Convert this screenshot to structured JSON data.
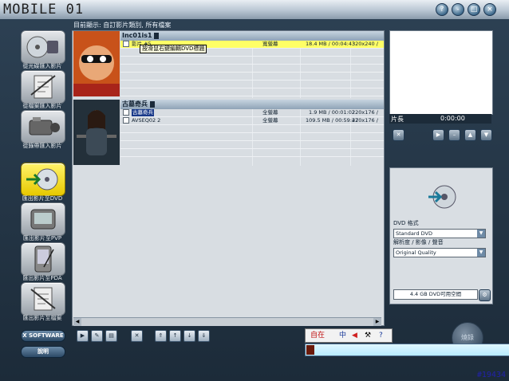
{
  "window": {
    "logo": "MOBILE 01",
    "controls": [
      "?",
      "-",
      "□",
      "×"
    ]
  },
  "sidebar": {
    "items": [
      {
        "label": "從光碟匯入影片",
        "icon": "disc-import-icon"
      },
      {
        "label": "從檔案匯入影片",
        "icon": "file-import-icon"
      },
      {
        "label": "從錄帶匯入影片",
        "icon": "camcorder-icon"
      },
      {
        "label": "匯出影片至DVD",
        "icon": "dvd-export-icon"
      },
      {
        "label": "匯出影片至PVP",
        "icon": "pvp-export-icon"
      },
      {
        "label": "匯出影片至PDA",
        "icon": "pda-export-icon"
      },
      {
        "label": "匯出影片至檔案",
        "icon": "file-export-icon"
      }
    ],
    "brand_button": "X SOFTWARE",
    "help_button": "說明"
  },
  "info_text": "目前顯示: 自訂影片類別, 所有檔案",
  "groups": [
    {
      "title": "Inc01is1",
      "tooltip": "按滑鼠右鍵編輯DVD標題",
      "rows": [
        {
          "name": "影片 #5",
          "screen": "寬螢幕",
          "size": "18.4 MB / 00:04:43",
          "res": "320x240 /"
        }
      ]
    },
    {
      "title": "古墓奇兵",
      "rows": [
        {
          "name": "古墓奇兵",
          "screen": "全螢幕",
          "size": "1.9 MB / 00:01:02",
          "res": "220x176 /"
        },
        {
          "name": "AVSEQ02 2",
          "screen": "全螢幕",
          "size": "109.5 MB / 00:59:47",
          "res": "220x176 /"
        }
      ]
    }
  ],
  "preview": {
    "length_label": "片長",
    "time": "0:00:00"
  },
  "dvd_panel": {
    "format_label": "DVD 格式",
    "format_value": "Standard DVD",
    "quality_label": "解析度 / 影像 / 聲音",
    "quality_value": "Original Quality",
    "space": "4.4 GB DVD可用空間"
  },
  "burn_button": "燒錄",
  "ime": {
    "brand": "自在",
    "mode": "中"
  },
  "watermark": "#19434"
}
